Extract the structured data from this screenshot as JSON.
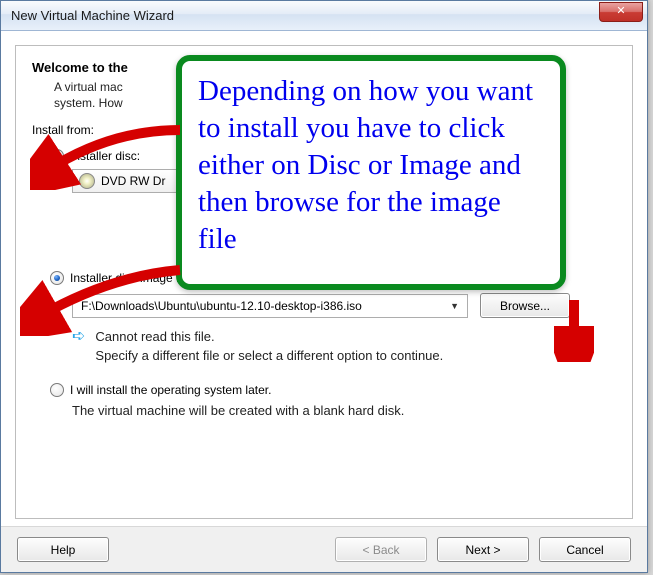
{
  "window": {
    "title": "New Virtual Machine Wizard",
    "close_glyph": "✕"
  },
  "header": {
    "heading": "Welcome to the",
    "subhead_line1": "A virtual mac",
    "subhead_line2": "system. How"
  },
  "install": {
    "label": "Install from:",
    "opt_disc": {
      "label": "Installer disc:",
      "drive_text": "DVD RW Dr"
    },
    "opt_iso": {
      "label": "Installer disc image file (iso):",
      "path": "F:\\Downloads\\Ubuntu\\ubuntu-12.10-desktop-i386.iso",
      "browse": "Browse...",
      "warn_line1": "Cannot read this file.",
      "warn_line2": "Specify a different file or select a different option to continue."
    },
    "opt_later": {
      "label": "I will install the operating system later.",
      "note": "The virtual machine will be created with a blank hard disk."
    }
  },
  "buttons": {
    "help": "Help",
    "back": "< Back",
    "next": "Next >",
    "cancel": "Cancel"
  },
  "annotation": {
    "text": "Depending on how you want to install you have to click either on Disc or Image and then browse for the image file"
  }
}
